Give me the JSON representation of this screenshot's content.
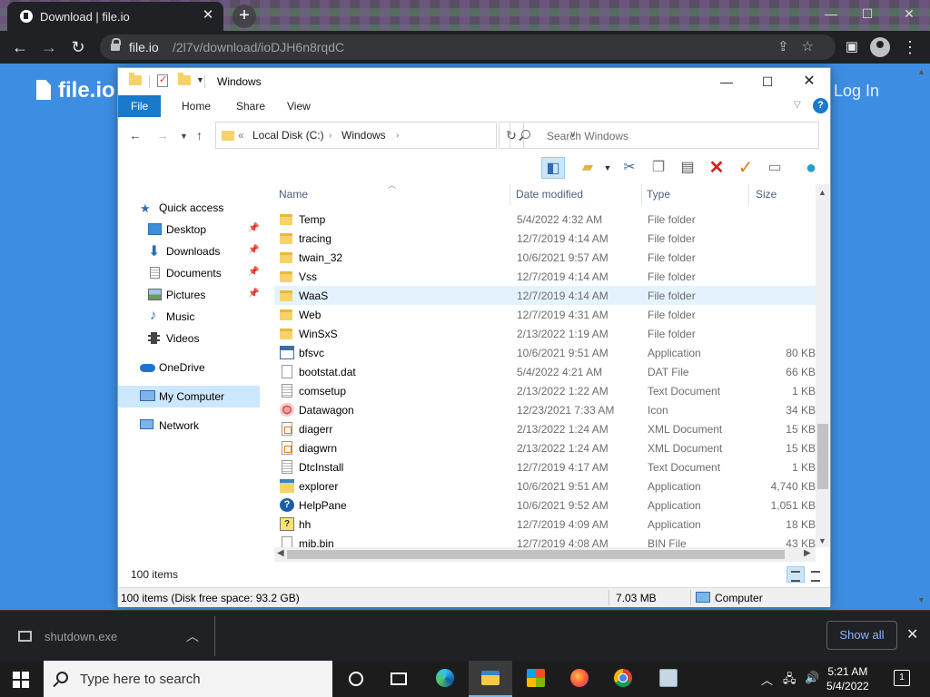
{
  "browser": {
    "tab_title": "Download | file.io",
    "url_domain": "file.io",
    "url_path": "/2l7v/download/ioDJH6n8rqdC"
  },
  "site": {
    "logo_text": "file.io",
    "login_link": "Log In"
  },
  "explorer": {
    "window_title": "Windows",
    "ribbon_tabs": [
      "File",
      "Home",
      "Share",
      "View"
    ],
    "address": {
      "crumbs": [
        "Local Disk (C:)",
        "Windows"
      ]
    },
    "search_placeholder": "Search Windows",
    "nav": {
      "quick_access": "Quick access",
      "desktop": "Desktop",
      "downloads": "Downloads",
      "documents": "Documents",
      "pictures": "Pictures",
      "music": "Music",
      "videos": "Videos",
      "onedrive": "OneDrive",
      "my_computer": "My Computer",
      "network": "Network"
    },
    "columns": {
      "name": "Name",
      "date": "Date modified",
      "type": "Type",
      "size": "Size"
    },
    "files": [
      {
        "name": "Temp",
        "date": "5/4/2022 4:32 AM",
        "type": "File folder",
        "size": "",
        "icon": "folder-icon"
      },
      {
        "name": "tracing",
        "date": "12/7/2019 4:14 AM",
        "type": "File folder",
        "size": "",
        "icon": "folder-icon"
      },
      {
        "name": "twain_32",
        "date": "10/6/2021 9:57 AM",
        "type": "File folder",
        "size": "",
        "icon": "folder-icon"
      },
      {
        "name": "Vss",
        "date": "12/7/2019 4:14 AM",
        "type": "File folder",
        "size": "",
        "icon": "folder-icon"
      },
      {
        "name": "WaaS",
        "date": "12/7/2019 4:14 AM",
        "type": "File folder",
        "size": "",
        "icon": "folder-icon"
      },
      {
        "name": "Web",
        "date": "12/7/2019 4:31 AM",
        "type": "File folder",
        "size": "",
        "icon": "folder-icon"
      },
      {
        "name": "WinSxS",
        "date": "2/13/2022 1:19 AM",
        "type": "File folder",
        "size": "",
        "icon": "folder-icon"
      },
      {
        "name": "bfsvc",
        "date": "10/6/2021 9:51 AM",
        "type": "Application",
        "size": "80 KB",
        "icon": "application-icon"
      },
      {
        "name": "bootstat.dat",
        "date": "5/4/2022 4:21 AM",
        "type": "DAT File",
        "size": "66 KB",
        "icon": "file-icon"
      },
      {
        "name": "comsetup",
        "date": "2/13/2022 1:22 AM",
        "type": "Text Document",
        "size": "1 KB",
        "icon": "text-file-icon"
      },
      {
        "name": "Datawagon",
        "date": "12/23/2021 7:33 AM",
        "type": "Icon",
        "size": "34 KB",
        "icon": "image-icon"
      },
      {
        "name": "diagerr",
        "date": "2/13/2022 1:24 AM",
        "type": "XML Document",
        "size": "15 KB",
        "icon": "xml-file-icon"
      },
      {
        "name": "diagwrn",
        "date": "2/13/2022 1:24 AM",
        "type": "XML Document",
        "size": "15 KB",
        "icon": "xml-file-icon"
      },
      {
        "name": "DtcInstall",
        "date": "12/7/2019 4:17 AM",
        "type": "Text Document",
        "size": "1 KB",
        "icon": "text-file-icon"
      },
      {
        "name": "explorer",
        "date": "10/6/2021 9:51 AM",
        "type": "Application",
        "size": "4,740 KB",
        "icon": "explorer-icon"
      },
      {
        "name": "HelpPane",
        "date": "10/6/2021 9:52 AM",
        "type": "Application",
        "size": "1,051 KB",
        "icon": "help-icon"
      },
      {
        "name": "hh",
        "date": "12/7/2019 4:09 AM",
        "type": "Application",
        "size": "18 KB",
        "icon": "help-file-icon"
      },
      {
        "name": "mib.bin",
        "date": "12/7/2019 4:08 AM",
        "type": "BIN File",
        "size": "43 KB",
        "icon": "file-icon"
      }
    ],
    "highlighted_row": 4,
    "item_count": "100 items",
    "status_summary": "100 items (Disk free space: 93.2 GB)",
    "status_size": "7.03 MB",
    "status_location": "Computer"
  },
  "download_shelf": {
    "file_name": "shutdown.exe",
    "show_all": "Show all"
  },
  "taskbar": {
    "search_placeholder": "Type here to search",
    "time": "5:21 AM",
    "date": "5/4/2022",
    "notification_count": "1"
  },
  "colors": {
    "page_background": "#3d8ee3",
    "ribbon_file_tab": "#1979ca",
    "chrome_dark": "#202124",
    "selection": "#cce8ff"
  }
}
